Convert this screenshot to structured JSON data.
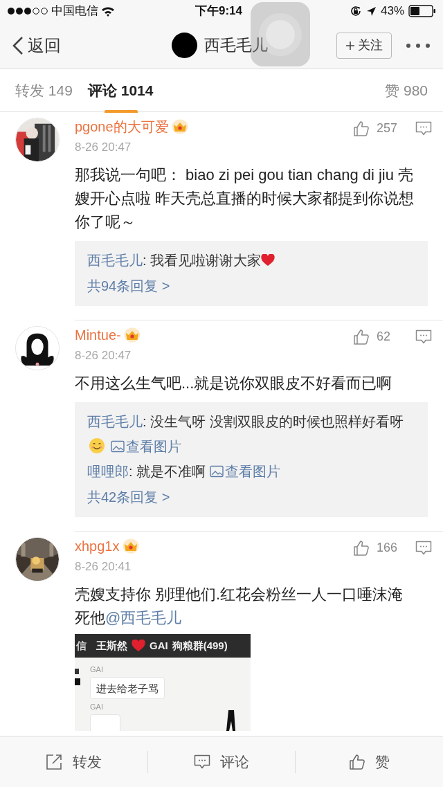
{
  "status_bar": {
    "carrier": "中国电信",
    "time": "下午9:14",
    "battery": "43%"
  },
  "nav": {
    "back": "返回",
    "title": "西毛毛儿",
    "follow": "关注"
  },
  "tabs": [
    {
      "label": "转发 149",
      "selected": false
    },
    {
      "label": "评论 1014",
      "selected": true
    }
  ],
  "likes_tab": "赞 980",
  "comments": [
    {
      "user": "pgone的大可爱",
      "vip": true,
      "time": "8-26 20:47",
      "likes": "257",
      "text": "那我说一句吧： biao zi pei gou tian chang di jiu 壳嫂开心点啦 昨天壳总直播的时候大家都提到你说想你了呢～",
      "replies": [
        {
          "user": "西毛毛儿",
          "text": ": 我看见啦谢谢大家",
          "heart": true
        }
      ],
      "more_replies": "共94条回复 >"
    },
    {
      "user": "Mintue-",
      "vip": true,
      "time": "8-26 20:47",
      "likes": "62",
      "text": "不用这么生气吧...就是说你双眼皮不好看而已啊",
      "replies": [
        {
          "user": "西毛毛儿",
          "text": ": 没生气呀 没割双眼皮的时候也照样好看呀",
          "smiley": true,
          "image_link": "查看图片"
        },
        {
          "user": "哩哩郎",
          "text": ": 就是不准啊",
          "image_link": "查看图片"
        }
      ],
      "more_replies": "共42条回复 >"
    },
    {
      "user": "xhpg1x",
      "vip": true,
      "time": "8-26 20:41",
      "likes": "166",
      "text": "壳嫂支持你 别理他们.红花会粉丝一人一口唾沫淹死他",
      "mention": "@西毛毛儿",
      "attachment": {
        "kind": "chat_screenshot",
        "header": [
          "信",
          "王斯然",
          "GAI",
          "狗粮群(499)"
        ],
        "messages": [
          {
            "sender": "GAI",
            "text": "进去给老子骂"
          },
          {
            "sender": "GAI"
          }
        ]
      }
    }
  ],
  "bottom_bar": [
    {
      "kind": "repost",
      "label": "转发"
    },
    {
      "kind": "comment",
      "label": "评论"
    },
    {
      "kind": "like",
      "label": "赞"
    }
  ]
}
